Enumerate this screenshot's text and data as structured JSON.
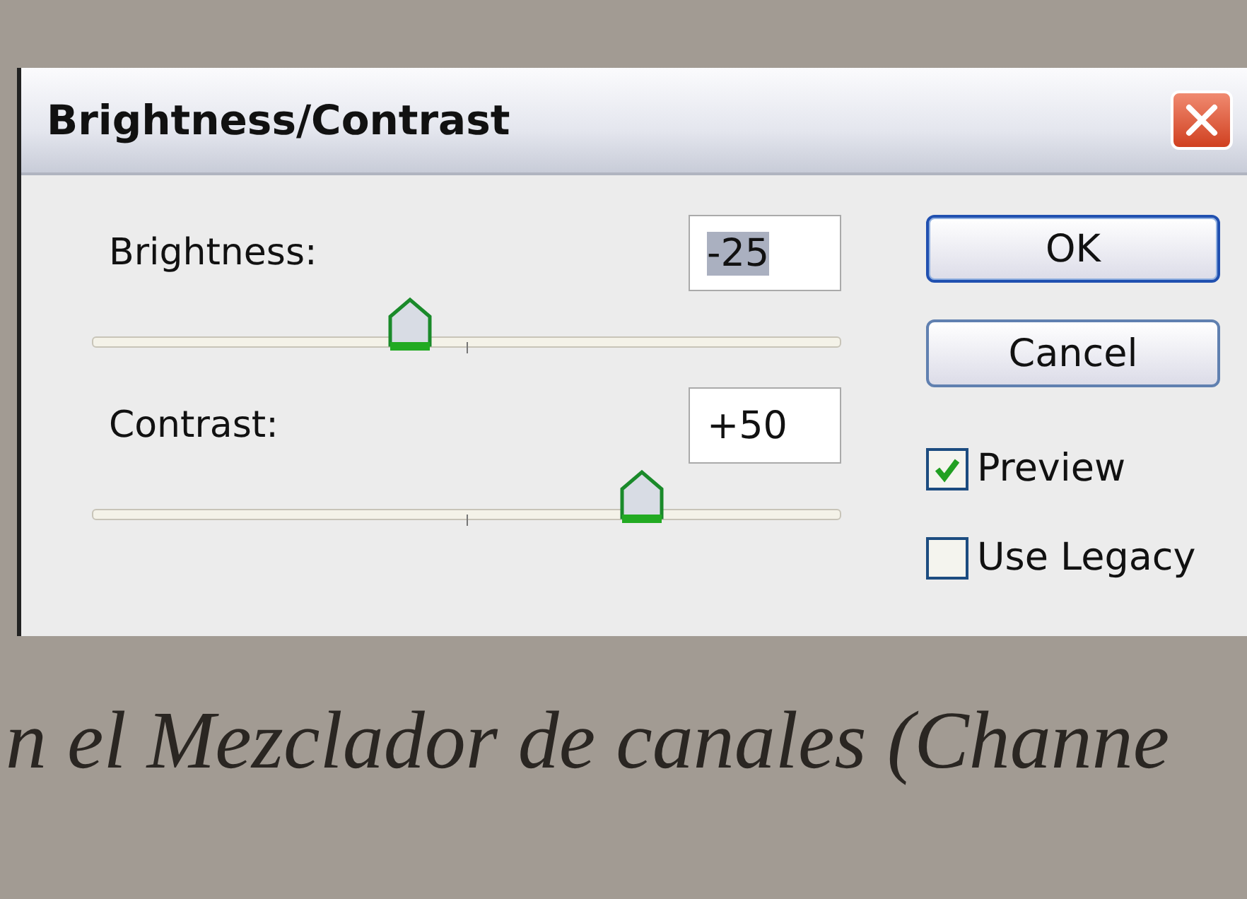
{
  "dialog": {
    "title": "Brightness/Contrast",
    "sliders": [
      {
        "label": "Brightness:",
        "value": "-25",
        "value_selected": true,
        "level": 0.42
      },
      {
        "label": "Contrast:",
        "value": "+50",
        "value_selected": false,
        "level": 0.75
      }
    ],
    "buttons": [
      {
        "label": "OK",
        "default": true
      },
      {
        "label": "Cancel",
        "default": false
      }
    ],
    "checkboxes": [
      {
        "label": "Preview",
        "checked": true
      },
      {
        "label": "Use Legacy",
        "checked": false
      }
    ]
  },
  "caption": "n el Mezclador de canales (Channe"
}
